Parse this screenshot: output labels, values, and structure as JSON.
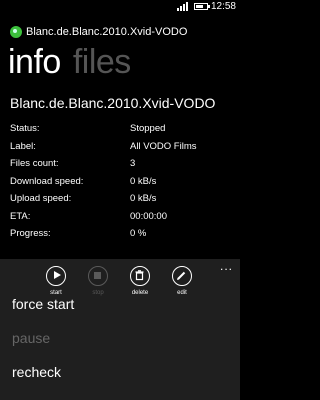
{
  "status_bar": {
    "time": "12:58",
    "signal_icon": "signal-icon",
    "battery_icon": "battery-icon",
    "battery_level_percent": 65
  },
  "app": {
    "title": "Blanc.de.Blanc.2010.Xvid-VODO",
    "icon": "utorrent-icon"
  },
  "pivot": {
    "active": "info",
    "inactive": "files"
  },
  "torrent": {
    "name": "Blanc.de.Blanc.2010.Xvid-VODO",
    "details": [
      {
        "label": "Status:",
        "value": "Stopped"
      },
      {
        "label": "Label:",
        "value": "All VODO Films"
      },
      {
        "label": "Files count:",
        "value": "3"
      },
      {
        "label": "Download speed:",
        "value": "0 kB/s"
      },
      {
        "label": "Upload speed:",
        "value": "0 kB/s"
      },
      {
        "label": "ETA:",
        "value": "00:00:00"
      },
      {
        "label": "Progress:",
        "value": "0 %"
      }
    ]
  },
  "app_bar": {
    "more": "...",
    "buttons": [
      {
        "label": "start",
        "icon": "play-icon",
        "enabled": true
      },
      {
        "label": "stop",
        "icon": "stop-icon",
        "enabled": false
      },
      {
        "label": "delete",
        "icon": "trash-icon",
        "enabled": true
      },
      {
        "label": "edit",
        "icon": "pencil-icon",
        "enabled": true
      }
    ],
    "menu": [
      {
        "label": "force start",
        "enabled": true
      },
      {
        "label": "pause",
        "enabled": false
      },
      {
        "label": "recheck",
        "enabled": true
      }
    ]
  }
}
